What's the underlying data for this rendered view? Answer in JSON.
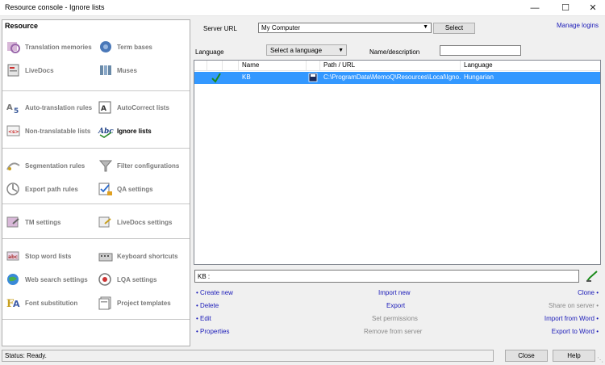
{
  "window": {
    "title": "Resource console - Ignore lists"
  },
  "left": {
    "header": "Resource",
    "items": [
      {
        "label": "Translation memories",
        "icon": "translation-memories-icon"
      },
      {
        "label": "Term bases",
        "icon": "term-bases-icon"
      },
      {
        "label": "LiveDocs",
        "icon": "livedocs-icon"
      },
      {
        "label": "Muses",
        "icon": "muses-icon"
      },
      {
        "label": "Auto-translation rules",
        "icon": "auto-translation-rules-icon"
      },
      {
        "label": "AutoCorrect lists",
        "icon": "autocorrect-lists-icon"
      },
      {
        "label": "Non-translatable lists",
        "icon": "non-translatable-lists-icon"
      },
      {
        "label": "Ignore lists",
        "icon": "ignore-lists-icon"
      },
      {
        "label": "Segmentation rules",
        "icon": "segmentation-rules-icon"
      },
      {
        "label": "Filter configurations",
        "icon": "filter-configurations-icon"
      },
      {
        "label": "Export path rules",
        "icon": "export-path-rules-icon"
      },
      {
        "label": "QA settings",
        "icon": "qa-settings-icon"
      },
      {
        "label": "TM settings",
        "icon": "tm-settings-icon"
      },
      {
        "label": "LiveDocs settings",
        "icon": "livedocs-settings-icon"
      },
      {
        "label": "Stop word lists",
        "icon": "stop-word-lists-icon"
      },
      {
        "label": "Keyboard shortcuts",
        "icon": "keyboard-shortcuts-icon"
      },
      {
        "label": "Web search settings",
        "icon": "web-search-settings-icon"
      },
      {
        "label": "LQA settings",
        "icon": "lqa-settings-icon"
      },
      {
        "label": "Font substitution",
        "icon": "font-substitution-icon"
      },
      {
        "label": "Project templates",
        "icon": "project-templates-icon"
      }
    ]
  },
  "server": {
    "label": "Server URL",
    "value": "My Computer",
    "select_label": "Select",
    "manage_logins": "Manage logins"
  },
  "filter": {
    "language_label": "Language",
    "language_value": "Select a language",
    "name_label": "Name/description",
    "name_value": ""
  },
  "grid": {
    "columns": [
      "Name",
      "Path / URL",
      "Language"
    ],
    "rows": [
      {
        "name": "KB",
        "path": "C:\\ProgramData\\MemoQ\\Resources\\Local\\Igno...",
        "language": "Hungarian"
      }
    ]
  },
  "description": {
    "value": "KB :"
  },
  "actions": {
    "create_new": "Create new",
    "delete": "Delete",
    "edit": "Edit",
    "properties": "Properties",
    "import_new": "Import new",
    "export": "Export",
    "set_permissions": "Set permissions",
    "remove_from_server": "Remove from server",
    "clone": "Clone",
    "share_on_server": "Share on server",
    "import_from_word": "Import from Word",
    "export_to_word": "Export to Word"
  },
  "status": {
    "text": "Status: Ready."
  },
  "footer": {
    "close_label": "Close",
    "help_label": "Help"
  },
  "colors": {
    "selection": "#3398ff",
    "link": "#1a1ab8",
    "check": "#1a8a1a"
  }
}
